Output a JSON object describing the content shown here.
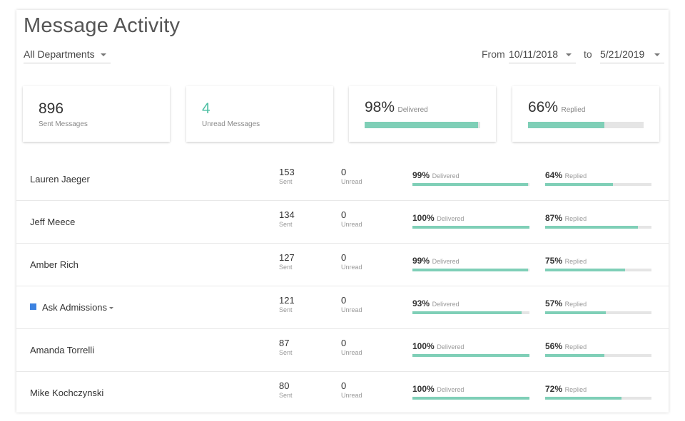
{
  "header": {
    "title": "Message Activity",
    "department": "All Departments",
    "from_label": "From",
    "from_date": "10/11/2018",
    "to_label": "to",
    "to_date": "5/21/2019"
  },
  "stats": {
    "sent": {
      "value": "896",
      "label": "Sent Messages"
    },
    "unread": {
      "value": "4",
      "label": "Unread Messages"
    },
    "delivered": {
      "value": "98%",
      "label": "Delivered",
      "fraction": 0.98
    },
    "replied": {
      "value": "66%",
      "label": "Replied",
      "fraction": 0.66
    }
  },
  "colors": {
    "accent": "#7fcfb7",
    "teal_text": "#4cbfa3",
    "department_marker": "#3c82e0"
  },
  "rows": [
    {
      "name": "Lauren Jaeger",
      "sent": "153",
      "sent_label": "Sent",
      "unread": "0",
      "unread_label": "Unread",
      "delivered": "99%",
      "delivered_label": "Delivered",
      "delivered_fraction": 0.99,
      "replied": "64%",
      "replied_label": "Replied",
      "replied_fraction": 0.64
    },
    {
      "name": "Jeff Meece",
      "sent": "134",
      "sent_label": "Sent",
      "unread": "0",
      "unread_label": "Unread",
      "delivered": "100%",
      "delivered_label": "Delivered",
      "delivered_fraction": 1.0,
      "replied": "87%",
      "replied_label": "Replied",
      "replied_fraction": 0.87
    },
    {
      "name": "Amber Rich",
      "sent": "127",
      "sent_label": "Sent",
      "unread": "0",
      "unread_label": "Unread",
      "delivered": "99%",
      "delivered_label": "Delivered",
      "delivered_fraction": 0.99,
      "replied": "75%",
      "replied_label": "Replied",
      "replied_fraction": 0.75
    },
    {
      "name": "Ask Admissions",
      "sent": "121",
      "sent_label": "Sent",
      "unread": "0",
      "unread_label": "Unread",
      "delivered": "93%",
      "delivered_label": "Delivered",
      "delivered_fraction": 0.93,
      "replied": "57%",
      "replied_label": "Replied",
      "replied_fraction": 0.57
    },
    {
      "name": "Amanda Torrelli",
      "sent": "87",
      "sent_label": "Sent",
      "unread": "0",
      "unread_label": "Unread",
      "delivered": "100%",
      "delivered_label": "Delivered",
      "delivered_fraction": 1.0,
      "replied": "56%",
      "replied_label": "Replied",
      "replied_fraction": 0.56
    },
    {
      "name": "Mike Kochczynski",
      "sent": "80",
      "sent_label": "Sent",
      "unread": "0",
      "unread_label": "Unread",
      "delivered": "100%",
      "delivered_label": "Delivered",
      "delivered_fraction": 1.0,
      "replied": "72%",
      "replied_label": "Replied",
      "replied_fraction": 0.72
    }
  ]
}
